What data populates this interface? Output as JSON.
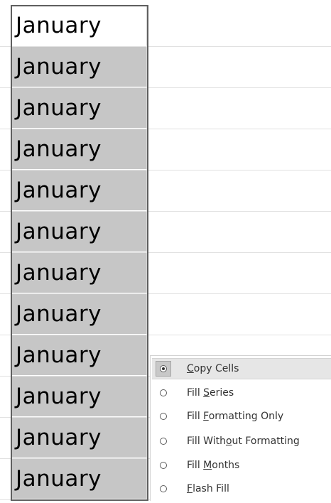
{
  "cells": [
    {
      "value": "January",
      "state": "active"
    },
    {
      "value": "January",
      "state": "selected"
    },
    {
      "value": "January",
      "state": "selected"
    },
    {
      "value": "January",
      "state": "selected"
    },
    {
      "value": "January",
      "state": "selected"
    },
    {
      "value": "January",
      "state": "selected"
    },
    {
      "value": "January",
      "state": "selected"
    },
    {
      "value": "January",
      "state": "selected"
    },
    {
      "value": "January",
      "state": "selected"
    },
    {
      "value": "January",
      "state": "selected"
    },
    {
      "value": "January",
      "state": "selected"
    },
    {
      "value": "January",
      "state": "selected"
    }
  ],
  "autofill_menu": {
    "items": [
      {
        "pre": "",
        "key": "C",
        "post": "opy Cells",
        "checked": true
      },
      {
        "pre": "Fill ",
        "key": "S",
        "post": "eries",
        "checked": false
      },
      {
        "pre": "Fill ",
        "key": "F",
        "post": "ormatting Only",
        "checked": false
      },
      {
        "pre": "Fill With",
        "key": "o",
        "post": "ut Formatting",
        "checked": false
      },
      {
        "pre": "Fill ",
        "key": "M",
        "post": "onths",
        "checked": false
      },
      {
        "pre": "",
        "key": "F",
        "post": "lash Fill",
        "checked": false
      }
    ]
  },
  "colors": {
    "selection_fill": "#c6c6c6",
    "selection_border": "#5f5f5f",
    "gridline": "#e1e1e1",
    "menu_checked_bg": "#e6e6e6"
  }
}
